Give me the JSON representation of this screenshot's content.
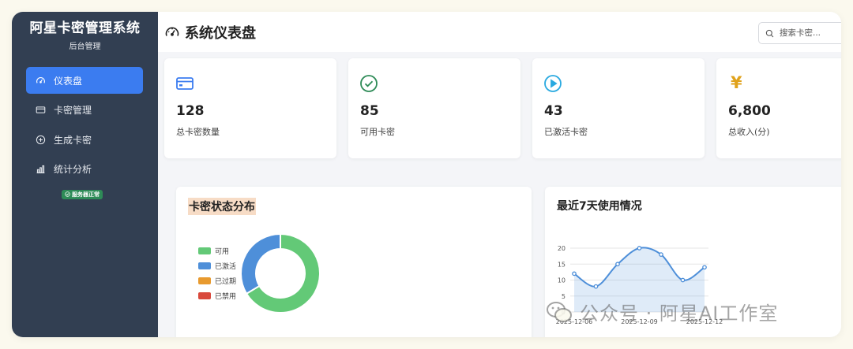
{
  "sidebar": {
    "title": "阿星卡密管理系统",
    "subtitle": "后台管理",
    "items": [
      {
        "label": "仪表盘",
        "icon": "gauge-icon",
        "active": true
      },
      {
        "label": "卡密管理",
        "icon": "card-icon"
      },
      {
        "label": "生成卡密",
        "icon": "plus-circle-icon"
      },
      {
        "label": "统计分析",
        "icon": "bar-chart-icon"
      }
    ],
    "status_badge": "服务器正常"
  },
  "header": {
    "title": "系统仪表盘",
    "search_placeholder": "搜索卡密..."
  },
  "stats": [
    {
      "value": "128",
      "label": "总卡密数量",
      "icon": "card-icon",
      "color": "#3b7cf0"
    },
    {
      "value": "85",
      "label": "可用卡密",
      "icon": "check-circle-icon",
      "color": "#2e8b57"
    },
    {
      "value": "43",
      "label": "已激活卡密",
      "icon": "play-circle-icon",
      "color": "#29a9e0"
    },
    {
      "value": "6,800",
      "label": "总收入(分)",
      "icon": "yen-icon",
      "glyph": "¥",
      "color": "#e0a21b"
    }
  ],
  "charts": {
    "pie_title": "卡密状态分布",
    "line_title": "最近7天使用情况"
  },
  "chart_data": [
    {
      "type": "pie",
      "title": "卡密状态分布",
      "series": [
        {
          "name": "可用",
          "value": 85,
          "color": "#63c977"
        },
        {
          "name": "已激活",
          "value": 43,
          "color": "#4e8fd9"
        },
        {
          "name": "已过期",
          "value": 0,
          "color": "#e89a2f"
        },
        {
          "name": "已禁用",
          "value": 0,
          "color": "#d9493c"
        }
      ]
    },
    {
      "type": "area",
      "title": "最近7天使用情况",
      "x": [
        "2025-12-06",
        "2025-12-07",
        "2025-12-08",
        "2025-12-09",
        "2025-12-10",
        "2025-12-11",
        "2025-12-12"
      ],
      "x_tick_labels": [
        "2025-12-06",
        "2025-12-09",
        "2025-12-12"
      ],
      "y": [
        12,
        8,
        15,
        20,
        18,
        10,
        14
      ],
      "ylim": [
        0,
        20
      ],
      "y_ticks": [
        0,
        5,
        10,
        15,
        20
      ],
      "color": "#4e8fd9",
      "grid": true
    }
  ],
  "watermark": "公众号 · 阿星AI工作室"
}
